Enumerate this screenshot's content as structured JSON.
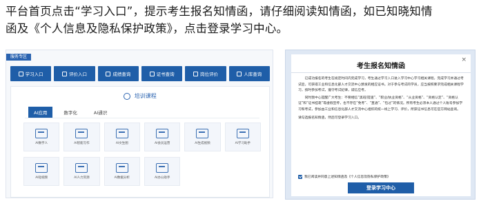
{
  "instruction": {
    "line1": "平台首页点击“学习入口”，提示考生报名知情函，请仔细阅读知情函，如已知晓知情",
    "line2": "函及《个人信息及隐私保护政策》，点击登录学习中心。"
  },
  "service": {
    "tag": "服务专区",
    "buttons": [
      {
        "label": "学习入口",
        "icon": "login-icon"
      },
      {
        "label": "评价入口",
        "icon": "evaluation-icon"
      },
      {
        "label": "成绩查询",
        "icon": "score-icon"
      },
      {
        "label": "证书查询",
        "icon": "certificate-icon"
      },
      {
        "label": "岗位评价",
        "icon": "position-icon"
      },
      {
        "label": "人库查询",
        "icon": "database-icon"
      }
    ]
  },
  "training": {
    "title": "培训课程",
    "tabs": [
      "AI应用",
      "数字化",
      "AI通识"
    ],
    "active_tab": "AI应用",
    "courses": [
      "AI数字人",
      "AI智能写作",
      "AI文生图",
      "AI会员运营",
      "AI生成视频",
      "AI学习助手",
      "AI短视频",
      "AI人力资源",
      "AI数据分析",
      "AI办公助手"
    ]
  },
  "notice": {
    "title": "考生报名知情函",
    "close": "×",
    "paragraphs": [
      "已成功报名的考生在规定时间内完成学习，考生通过学习入口进入学习中心学习相关课程，完成学习并通过考试后，可获得工业和信息化部人才交流中心颁发的相应证书。对于参与考试的学员，应当按照要求完成相关课程学习，按时参加考试，遵守考试纪律，诚信应考。",
      "同时我中心提醒广大考生：不要相信“黑班/提速”、“职业/执业资格”、“从业资格”、“资格认定”、“资格认证”和“证书挂靠”等虚假宣传，也不存在“免考”、“直通”、“包过”的情况。所有考生必须本人通过个人账号参加学习和考试，参加由工业和信息化部人才交流中心组织的统一线上学习、评价，所获证书信息可在官方网站查询。"
    ],
    "reminder": "请勾选报名知情函，然后可登录学习入口。",
    "agree": "我已阅读并同意上述知情函及《个人信息及隐私保护政策》",
    "login_button": "登录学习中心"
  },
  "colors": {
    "brand_blue": "#1f5ea8",
    "panel_bg": "#dfe8f4"
  }
}
